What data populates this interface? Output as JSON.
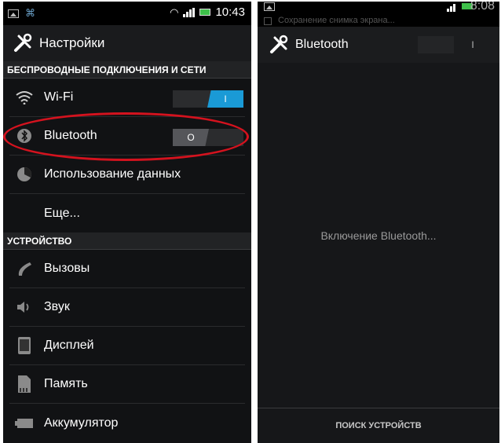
{
  "left": {
    "statusbar": {
      "time": "10:43"
    },
    "actionbar": {
      "title": "Настройки"
    },
    "sections": [
      {
        "header": "БЕСПРОВОДНЫЕ ПОДКЛЮЧЕНИЯ И СЕТИ",
        "items": [
          {
            "label": "Wi-Fi",
            "icon": "wifi-icon",
            "toggle": "on",
            "toggle_text": "I"
          },
          {
            "label": "Bluetooth",
            "icon": "bluetooth-icon",
            "toggle": "off",
            "toggle_text": "O"
          },
          {
            "label": "Использование данных",
            "icon": "data-usage-icon"
          },
          {
            "label": "Еще...",
            "icon": ""
          }
        ]
      },
      {
        "header": "УСТРОЙСТВО",
        "items": [
          {
            "label": "Вызовы",
            "icon": "phone-icon"
          },
          {
            "label": "Звук",
            "icon": "speaker-icon"
          },
          {
            "label": "Дисплей",
            "icon": "display-icon"
          },
          {
            "label": "Память",
            "icon": "memory-card-icon"
          },
          {
            "label": "Аккумулятор",
            "icon": "battery-icon"
          }
        ]
      }
    ]
  },
  "right": {
    "statusbar": {
      "time": "8:08",
      "faded_text": "Сохранение снимка экрана..."
    },
    "actionbar": {
      "title": "Bluetooth",
      "toggle_text": "I"
    },
    "status_message": "Включение Bluetooth...",
    "bottom_button": "ПОИСК УСТРОЙСТВ"
  },
  "colors": {
    "accent": "#1a9ad6",
    "highlight": "#d4121e",
    "background": "#111214"
  }
}
